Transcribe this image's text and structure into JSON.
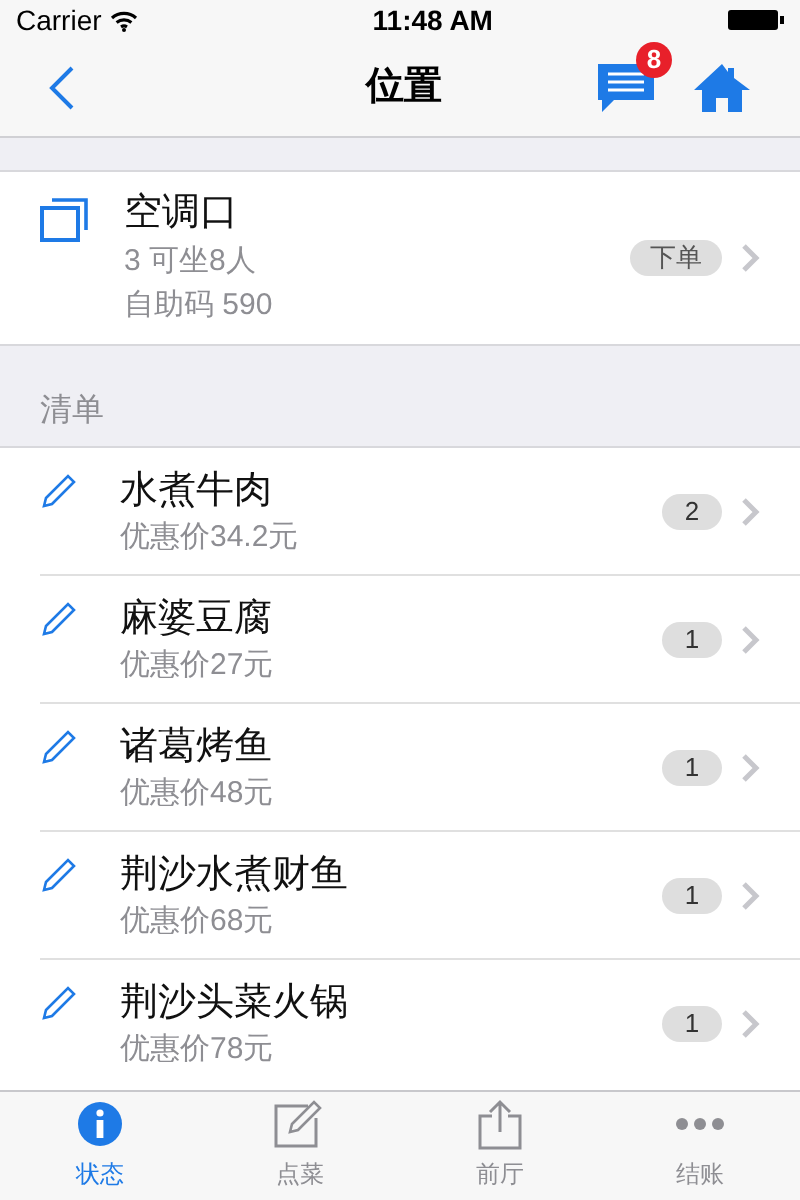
{
  "status_bar": {
    "carrier": "Carrier",
    "time": "11:48 AM"
  },
  "nav_bar": {
    "title": "位置",
    "message_badge": "8"
  },
  "table_card": {
    "name": "空调口",
    "seats": "3 可坐8人",
    "code": "自助码 590",
    "action": "下单"
  },
  "section": {
    "title": "清单"
  },
  "dishes": [
    {
      "name": "水煮牛肉",
      "price": "优惠价34.2元",
      "quantity": "2"
    },
    {
      "name": "麻婆豆腐",
      "price": "优惠价27元",
      "quantity": "1"
    },
    {
      "name": "诸葛烤鱼",
      "price": "优惠价48元",
      "quantity": "1"
    },
    {
      "name": "荆沙水煮财鱼",
      "price": "优惠价68元",
      "quantity": "1"
    },
    {
      "name": "荆沙头菜火锅",
      "price": "优惠价78元",
      "quantity": "1"
    }
  ],
  "tab_bar": [
    {
      "label": "状态",
      "kind": "info",
      "selected": true
    },
    {
      "label": "点菜",
      "kind": "edit",
      "selected": false
    },
    {
      "label": "前厅",
      "kind": "share",
      "selected": false
    },
    {
      "label": "结账",
      "kind": "more",
      "selected": false
    }
  ]
}
